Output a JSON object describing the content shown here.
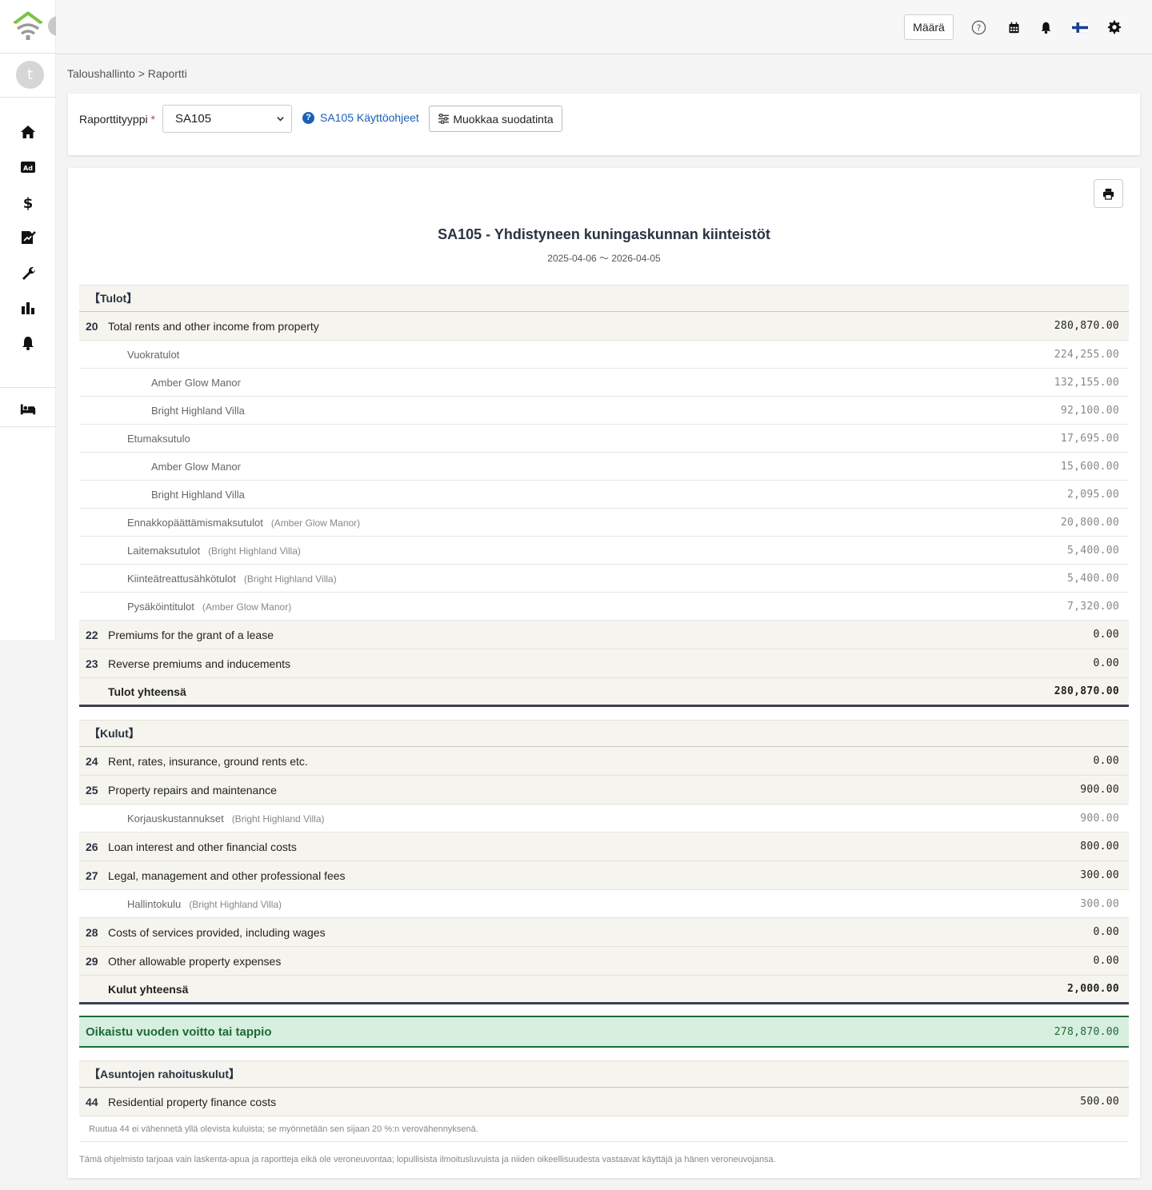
{
  "sidebar": {
    "avatar_letter": "t",
    "icons": [
      "home-icon",
      "ad-icon",
      "dollar-icon",
      "signature-icon",
      "wrench-icon",
      "chart-icon",
      "bell-icon",
      "bed-icon"
    ]
  },
  "topbar": {
    "amount_label": "Määrä"
  },
  "breadcrumb": "Taloushallinto > Raportti",
  "filter": {
    "label": "Raporttityyppi",
    "required_mark": "*",
    "selected": "SA105",
    "help_link": "SA105 Käyttöohjeet",
    "edit_filter": "Muokkaa suodatinta"
  },
  "report": {
    "title": "SA105 - Yhdistyneen kuningaskunnan kiinteistöt",
    "period": "2025-04-06 〜 2026-04-05",
    "income": {
      "heading": "【Tulot】",
      "box20": {
        "num": "20",
        "label": "Total rents and other income from property",
        "value": "280,870.00"
      },
      "sub": [
        {
          "label": "Vuokratulot",
          "note": "",
          "value": "224,255.00",
          "indent": 1
        },
        {
          "label": "Amber Glow Manor",
          "note": "",
          "value": "132,155.00",
          "indent": 2
        },
        {
          "label": "Bright Highland Villa",
          "note": "",
          "value": "92,100.00",
          "indent": 2
        },
        {
          "label": "Etumaksutulo",
          "note": "",
          "value": "17,695.00",
          "indent": 1
        },
        {
          "label": "Amber Glow Manor",
          "note": "",
          "value": "15,600.00",
          "indent": 2
        },
        {
          "label": "Bright Highland Villa",
          "note": "",
          "value": "2,095.00",
          "indent": 2
        },
        {
          "label": "Ennakkopäättämismaksutulot",
          "note": "(Amber Glow Manor)",
          "value": "20,800.00",
          "indent": 1
        },
        {
          "label": "Laitemaksutulot",
          "note": "(Bright Highland Villa)",
          "value": "5,400.00",
          "indent": 1
        },
        {
          "label": "Kiinteätreattusähkötulot",
          "note": "(Bright Highland Villa)",
          "value": "5,400.00",
          "indent": 1
        },
        {
          "label": "Pysäköintitulot",
          "note": "(Amber Glow Manor)",
          "value": "7,320.00",
          "indent": 1
        }
      ],
      "box22": {
        "num": "22",
        "label": "Premiums for the grant of a lease",
        "value": "0.00"
      },
      "box23": {
        "num": "23",
        "label": "Reverse premiums and inducements",
        "value": "0.00"
      },
      "total": {
        "label": "Tulot yhteensä",
        "value": "280,870.00"
      }
    },
    "expenses": {
      "heading": "【Kulut】",
      "box24": {
        "num": "24",
        "label": "Rent, rates, insurance, ground rents etc.",
        "value": "0.00"
      },
      "box25": {
        "num": "25",
        "label": "Property repairs and maintenance",
        "value": "900.00"
      },
      "box25_sub": {
        "label": "Korjauskustannukset",
        "note": "(Bright Highland Villa)",
        "value": "900.00"
      },
      "box26": {
        "num": "26",
        "label": "Loan interest and other financial costs",
        "value": "800.00"
      },
      "box27": {
        "num": "27",
        "label": "Legal, management and other professional fees",
        "value": "300.00"
      },
      "box27_sub": {
        "label": "Hallintokulu",
        "note": "(Bright Highland Villa)",
        "value": "300.00"
      },
      "box28": {
        "num": "28",
        "label": "Costs of services provided, including wages",
        "value": "0.00"
      },
      "box29": {
        "num": "29",
        "label": "Other allowable property expenses",
        "value": "0.00"
      },
      "total": {
        "label": "Kulut yhteensä",
        "value": "2,000.00"
      }
    },
    "profit": {
      "label": "Oikaistu vuoden voitto tai tappio",
      "value": "278,870.00"
    },
    "finance": {
      "heading": "【Asuntojen rahoituskulut】",
      "box44": {
        "num": "44",
        "label": "Residential property finance costs",
        "value": "500.00"
      },
      "note": "Ruutua 44 ei vähennetä yllä olevista kuluista; se myönnetään sen sijaan 20 %:n verovähennyksenä."
    },
    "disclaimer": "Tämä ohjelmisto tarjoaa vain laskenta-apua ja raportteja eikä ole veroneuvontaa; lopullisista ilmoitusluvuista ja niiden oikeellisuudesta vastaavat käyttäjä ja hänen veroneuvojansa."
  },
  "colors": {
    "accent_green": "#1e6b35",
    "logo_green": "#7cc242",
    "link_blue": "#1a5fb4"
  }
}
